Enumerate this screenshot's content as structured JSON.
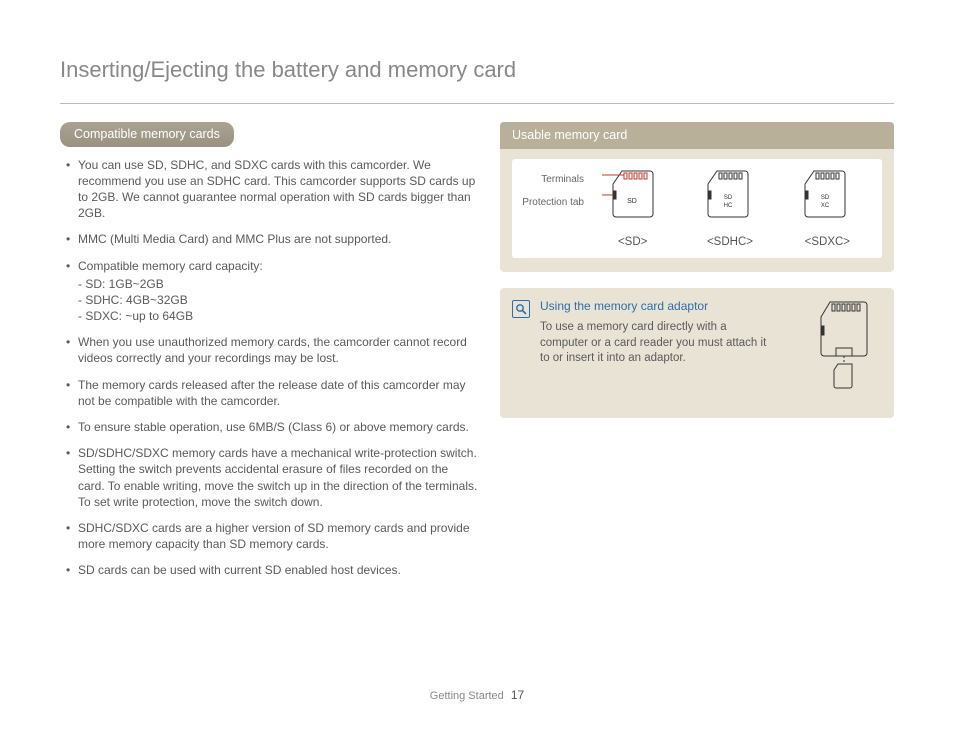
{
  "page_title": "Inserting/Ejecting the battery and memory card",
  "section_heading": "Compatible memory cards",
  "bullets": [
    {
      "text": "You can use SD, SDHC, and SDXC cards with this camcorder. We recommend you use an SDHC card. This camcorder supports SD cards up to 2GB. We cannot guarantee normal operation with SD cards bigger than 2GB."
    },
    {
      "text": "MMC (Multi Media Card) and MMC Plus are not supported."
    },
    {
      "text": "Compatible memory card capacity:",
      "sub": [
        "SD: 1GB~2GB",
        "SDHC: 4GB~32GB",
        "SDXC: ~up to 64GB"
      ]
    },
    {
      "text": "When you use unauthorized memory cards, the camcorder cannot record videos correctly and your recordings may be lost."
    },
    {
      "text": "The memory cards released after the release date of this camcorder may not be compatible with the camcorder."
    },
    {
      "text": "To ensure stable operation, use 6MB/S (Class 6) or above memory cards."
    },
    {
      "text": "SD/SDHC/SDXC memory cards have a mechanical write-protection switch. Setting the switch prevents accidental erasure of files recorded on the card. To enable writing, move the switch up in the direction of the terminals. To set write protection, move the switch down."
    },
    {
      "text": "SDHC/SDXC cards are a higher version of SD memory cards and provide more memory capacity than SD memory cards."
    },
    {
      "text": "SD cards can be used with current SD enabled host devices."
    }
  ],
  "usable_panel": {
    "header": "Usable memory card",
    "terminals_label": "Terminals",
    "protection_label": "Protection tab",
    "cards": [
      {
        "label": "<SD>"
      },
      {
        "label": "<SDHC>"
      },
      {
        "label": "<SDXC>"
      }
    ]
  },
  "adaptor_panel": {
    "title": "Using the memory card adaptor",
    "text": "To use a memory card directly with a computer or a card reader you must attach it to or insert it into an adaptor."
  },
  "footer": {
    "section": "Getting Started",
    "page": "17"
  }
}
